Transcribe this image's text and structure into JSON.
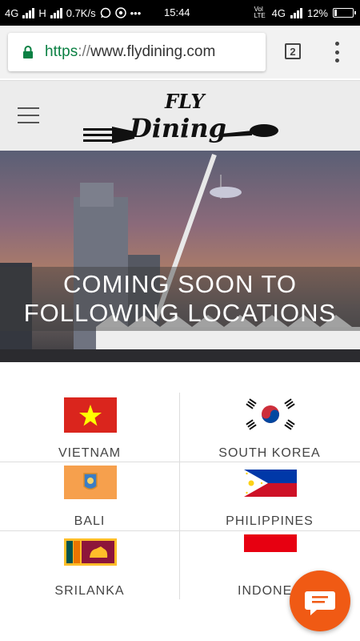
{
  "status_bar": {
    "network_left": "4G",
    "network_h": "H",
    "speed": "0.7K/s",
    "dots": "•••",
    "time": "15:44",
    "volte": "Vol LTE",
    "network_right": "4G",
    "battery": "12%"
  },
  "browser": {
    "url_scheme": "https",
    "url_sep": "://",
    "url_host": "www.flydining.com",
    "tab_count": "2"
  },
  "site": {
    "logo_top": "FLY",
    "logo_bottom": "Dining",
    "hero_line1": "COMING SOON TO",
    "hero_line2": "FOLLOWING LOCATIONS"
  },
  "locations": [
    {
      "name": "VIETNAM"
    },
    {
      "name": "SOUTH KOREA"
    },
    {
      "name": "BALI"
    },
    {
      "name": "PHILIPPINES"
    },
    {
      "name": "SRILANKA"
    },
    {
      "name": "INDONES"
    }
  ],
  "colors": {
    "accent": "#f05a14",
    "url_secure": "#0b8043"
  }
}
